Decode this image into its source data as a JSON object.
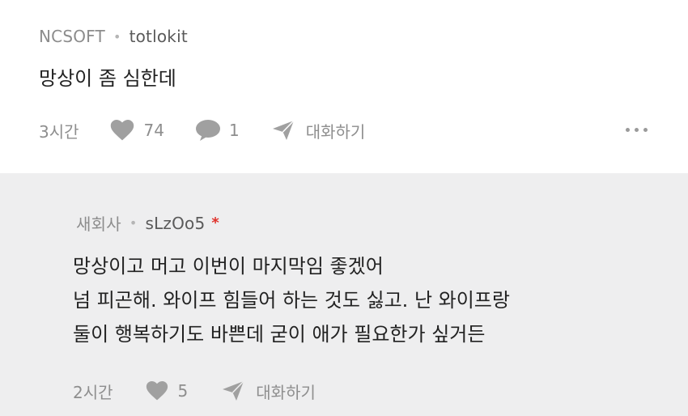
{
  "post": {
    "company": "NCSOFT",
    "nickname": "totlokit",
    "content": "망상이 좀 심한데",
    "time": "3시간",
    "likes": "74",
    "comments": "1",
    "chat_label": "대화하기"
  },
  "reply": {
    "company": "새회사",
    "nickname": "sLzOo5",
    "star": "*",
    "lines": [
      "망상이고 머고 이번이 마지막임 좋겠어",
      "넘 피곤해. 와이프 힘들어 하는 것도 싫고. 난 와이프랑",
      "둘이 행복하기도 바쁜데 굳이 애가 필요한가 싶거든"
    ],
    "time": "2시간",
    "likes": "5",
    "chat_label": "대화하기"
  },
  "icons": {
    "heart": "heart-icon",
    "comment": "comment-icon",
    "send": "send-icon",
    "more": "more-icon"
  },
  "colors": {
    "reply_background": "#eeeeef",
    "icon_gray": "#9a9a9a",
    "star_red": "#e0322b"
  }
}
